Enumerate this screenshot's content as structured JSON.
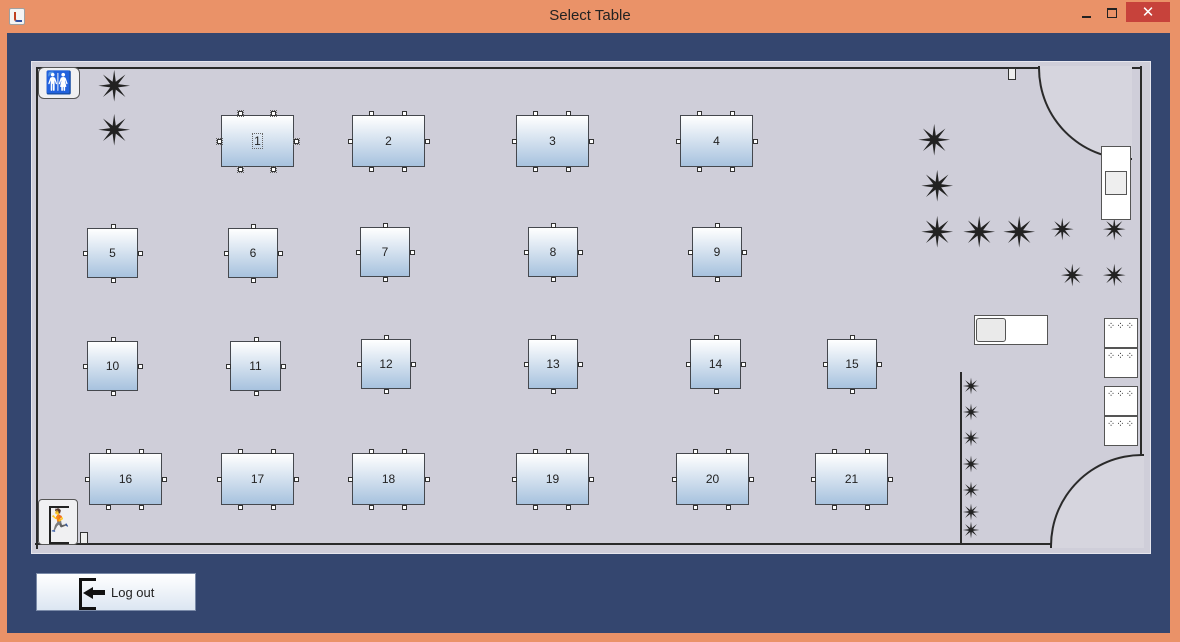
{
  "window": {
    "title": "Select Table",
    "close_glyph": "✕"
  },
  "tables": [
    {
      "label": "1"
    },
    {
      "label": "2"
    },
    {
      "label": "3"
    },
    {
      "label": "4"
    },
    {
      "label": "5"
    },
    {
      "label": "6"
    },
    {
      "label": "7"
    },
    {
      "label": "8"
    },
    {
      "label": "9"
    },
    {
      "label": "10"
    },
    {
      "label": "11"
    },
    {
      "label": "12"
    },
    {
      "label": "13"
    },
    {
      "label": "14"
    },
    {
      "label": "15"
    },
    {
      "label": "16"
    },
    {
      "label": "17"
    },
    {
      "label": "18"
    },
    {
      "label": "19"
    },
    {
      "label": "20"
    },
    {
      "label": "21"
    }
  ],
  "icons": {
    "restroom": "🚻",
    "exit": "🏃",
    "plant": "✴",
    "shelf_dots": "⁘⁘⁘"
  },
  "footer": {
    "logout_label": "Log out"
  },
  "colors": {
    "window_frame": "#ea9268",
    "content_bg": "#34466f",
    "floor_bg": "#cfced9",
    "close_button": "#c7423b"
  }
}
